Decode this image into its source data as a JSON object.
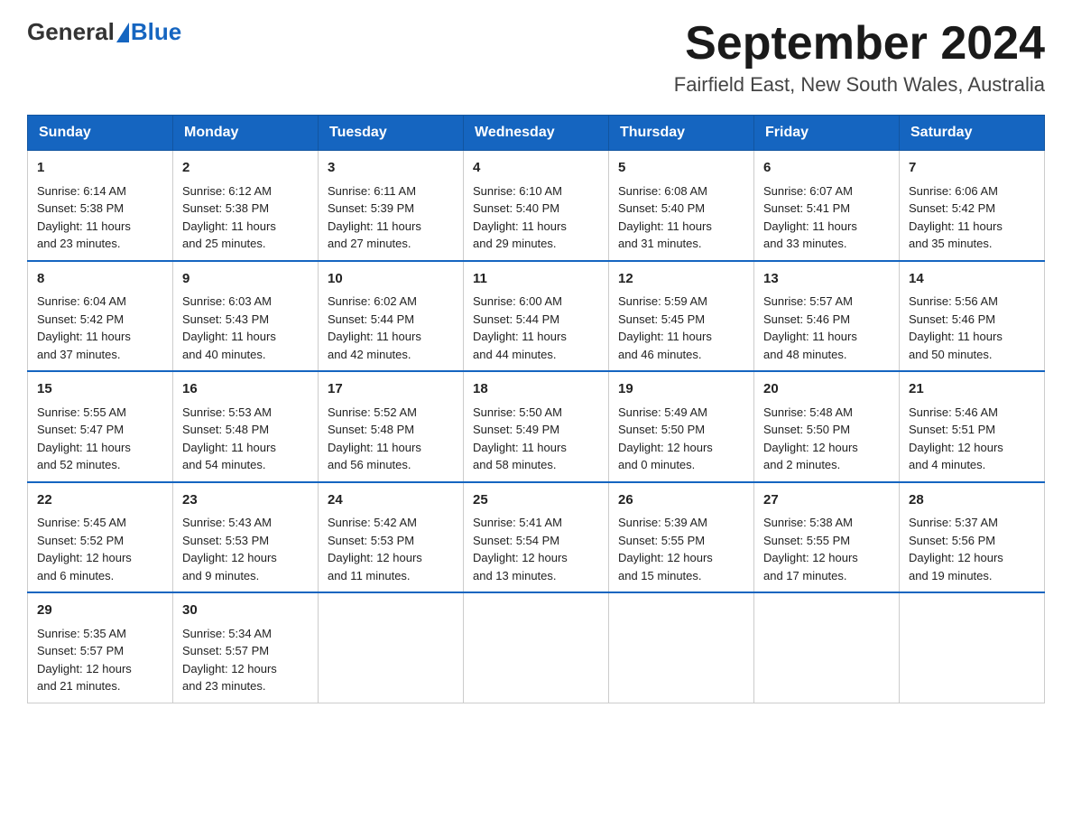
{
  "header": {
    "logo_general": "General",
    "logo_blue": "Blue",
    "month_title": "September 2024",
    "location": "Fairfield East, New South Wales, Australia"
  },
  "weekdays": [
    "Sunday",
    "Monday",
    "Tuesday",
    "Wednesday",
    "Thursday",
    "Friday",
    "Saturday"
  ],
  "weeks": [
    [
      {
        "day": "1",
        "sunrise": "6:14 AM",
        "sunset": "5:38 PM",
        "daylight": "11 hours and 23 minutes."
      },
      {
        "day": "2",
        "sunrise": "6:12 AM",
        "sunset": "5:38 PM",
        "daylight": "11 hours and 25 minutes."
      },
      {
        "day": "3",
        "sunrise": "6:11 AM",
        "sunset": "5:39 PM",
        "daylight": "11 hours and 27 minutes."
      },
      {
        "day": "4",
        "sunrise": "6:10 AM",
        "sunset": "5:40 PM",
        "daylight": "11 hours and 29 minutes."
      },
      {
        "day": "5",
        "sunrise": "6:08 AM",
        "sunset": "5:40 PM",
        "daylight": "11 hours and 31 minutes."
      },
      {
        "day": "6",
        "sunrise": "6:07 AM",
        "sunset": "5:41 PM",
        "daylight": "11 hours and 33 minutes."
      },
      {
        "day": "7",
        "sunrise": "6:06 AM",
        "sunset": "5:42 PM",
        "daylight": "11 hours and 35 minutes."
      }
    ],
    [
      {
        "day": "8",
        "sunrise": "6:04 AM",
        "sunset": "5:42 PM",
        "daylight": "11 hours and 37 minutes."
      },
      {
        "day": "9",
        "sunrise": "6:03 AM",
        "sunset": "5:43 PM",
        "daylight": "11 hours and 40 minutes."
      },
      {
        "day": "10",
        "sunrise": "6:02 AM",
        "sunset": "5:44 PM",
        "daylight": "11 hours and 42 minutes."
      },
      {
        "day": "11",
        "sunrise": "6:00 AM",
        "sunset": "5:44 PM",
        "daylight": "11 hours and 44 minutes."
      },
      {
        "day": "12",
        "sunrise": "5:59 AM",
        "sunset": "5:45 PM",
        "daylight": "11 hours and 46 minutes."
      },
      {
        "day": "13",
        "sunrise": "5:57 AM",
        "sunset": "5:46 PM",
        "daylight": "11 hours and 48 minutes."
      },
      {
        "day": "14",
        "sunrise": "5:56 AM",
        "sunset": "5:46 PM",
        "daylight": "11 hours and 50 minutes."
      }
    ],
    [
      {
        "day": "15",
        "sunrise": "5:55 AM",
        "sunset": "5:47 PM",
        "daylight": "11 hours and 52 minutes."
      },
      {
        "day": "16",
        "sunrise": "5:53 AM",
        "sunset": "5:48 PM",
        "daylight": "11 hours and 54 minutes."
      },
      {
        "day": "17",
        "sunrise": "5:52 AM",
        "sunset": "5:48 PM",
        "daylight": "11 hours and 56 minutes."
      },
      {
        "day": "18",
        "sunrise": "5:50 AM",
        "sunset": "5:49 PM",
        "daylight": "11 hours and 58 minutes."
      },
      {
        "day": "19",
        "sunrise": "5:49 AM",
        "sunset": "5:50 PM",
        "daylight": "12 hours and 0 minutes."
      },
      {
        "day": "20",
        "sunrise": "5:48 AM",
        "sunset": "5:50 PM",
        "daylight": "12 hours and 2 minutes."
      },
      {
        "day": "21",
        "sunrise": "5:46 AM",
        "sunset": "5:51 PM",
        "daylight": "12 hours and 4 minutes."
      }
    ],
    [
      {
        "day": "22",
        "sunrise": "5:45 AM",
        "sunset": "5:52 PM",
        "daylight": "12 hours and 6 minutes."
      },
      {
        "day": "23",
        "sunrise": "5:43 AM",
        "sunset": "5:53 PM",
        "daylight": "12 hours and 9 minutes."
      },
      {
        "day": "24",
        "sunrise": "5:42 AM",
        "sunset": "5:53 PM",
        "daylight": "12 hours and 11 minutes."
      },
      {
        "day": "25",
        "sunrise": "5:41 AM",
        "sunset": "5:54 PM",
        "daylight": "12 hours and 13 minutes."
      },
      {
        "day": "26",
        "sunrise": "5:39 AM",
        "sunset": "5:55 PM",
        "daylight": "12 hours and 15 minutes."
      },
      {
        "day": "27",
        "sunrise": "5:38 AM",
        "sunset": "5:55 PM",
        "daylight": "12 hours and 17 minutes."
      },
      {
        "day": "28",
        "sunrise": "5:37 AM",
        "sunset": "5:56 PM",
        "daylight": "12 hours and 19 minutes."
      }
    ],
    [
      {
        "day": "29",
        "sunrise": "5:35 AM",
        "sunset": "5:57 PM",
        "daylight": "12 hours and 21 minutes."
      },
      {
        "day": "30",
        "sunrise": "5:34 AM",
        "sunset": "5:57 PM",
        "daylight": "12 hours and 23 minutes."
      },
      null,
      null,
      null,
      null,
      null
    ]
  ],
  "labels": {
    "sunrise": "Sunrise:",
    "sunset": "Sunset:",
    "daylight": "Daylight:"
  }
}
